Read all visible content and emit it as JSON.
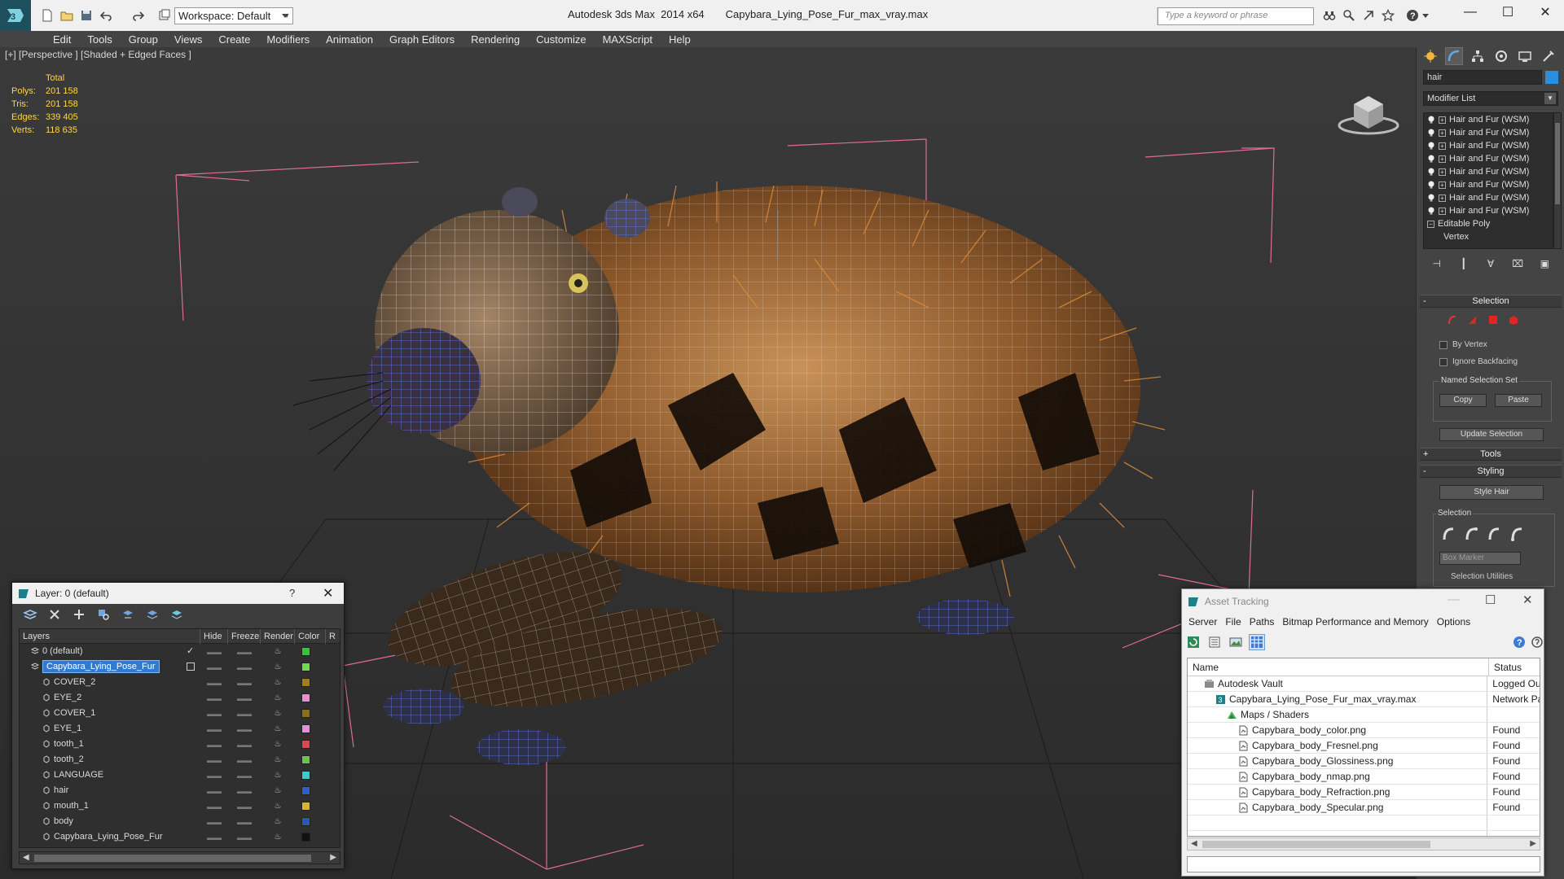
{
  "titlebar": {
    "workspace": "Workspace: Default",
    "app_name": "Autodesk 3ds Max  2014 x64",
    "file_name": "Capybara_Lying_Pose_Fur_max_vray.max",
    "search_placeholder": "Type a keyword or phrase"
  },
  "menu": [
    "Edit",
    "Tools",
    "Group",
    "Views",
    "Create",
    "Modifiers",
    "Animation",
    "Graph Editors",
    "Rendering",
    "Customize",
    "MAXScript",
    "Help"
  ],
  "viewport": {
    "label": "[+] [Perspective ] [Shaded + Edged Faces ]",
    "stats_header": "Total",
    "stats": [
      {
        "k": "Polys:",
        "v": "201 158"
      },
      {
        "k": "Tris:",
        "v": "201 158"
      },
      {
        "k": "Edges:",
        "v": "339 405"
      },
      {
        "k": "Verts:",
        "v": "118 635"
      }
    ]
  },
  "command_panel": {
    "search_value": "hair",
    "modifier_list": "Modifier List",
    "stack": [
      "Hair and Fur (WSM)",
      "Hair and Fur (WSM)",
      "Hair and Fur (WSM)",
      "Hair and Fur (WSM)",
      "Hair and Fur (WSM)",
      "Hair and Fur (WSM)",
      "Hair and Fur (WSM)",
      "Hair and Fur (WSM)"
    ],
    "base_object": "Editable Poly",
    "sub_object": "Vertex",
    "selection_rollout": "Selection",
    "by_vertex": "By Vertex",
    "ignore_backfacing": "Ignore Backfacing",
    "named_selection_set": "Named Selection Set",
    "copy": "Copy",
    "paste": "Paste",
    "update_selection": "Update Selection",
    "tools_rollout": "Tools",
    "styling_rollout": "Styling",
    "style_hair": "Style Hair",
    "selection_group": "Selection",
    "box_marker": "Box Marker",
    "selection_utilities": "Selection Utilities"
  },
  "layer_dialog": {
    "title": "Layer: 0 (default)",
    "help": "?",
    "columns": {
      "layers": "Layers",
      "hide": "Hide",
      "freeze": "Freeze",
      "render": "Render",
      "color": "Color",
      "extra": "R"
    },
    "rows": [
      {
        "name": "0 (default)",
        "color": "#3fbf3f",
        "level": 0,
        "selected": false
      },
      {
        "name": "Capybara_Lying_Pose_Fur",
        "color": "#6fd84f",
        "level": 0,
        "selected": true
      },
      {
        "name": "COVER_2",
        "color": "#a07d1e",
        "level": 1,
        "selected": false
      },
      {
        "name": "EYE_2",
        "color": "#e98fd0",
        "level": 1,
        "selected": false
      },
      {
        "name": "COVER_1",
        "color": "#8a6e1c",
        "level": 1,
        "selected": false
      },
      {
        "name": "EYE_1",
        "color": "#e48fd8",
        "level": 1,
        "selected": false
      },
      {
        "name": "tooth_1",
        "color": "#d94a4a",
        "level": 1,
        "selected": false
      },
      {
        "name": "tooth_2",
        "color": "#6cc24a",
        "level": 1,
        "selected": false
      },
      {
        "name": "LANGUAGE",
        "color": "#3fc9c9",
        "level": 1,
        "selected": false
      },
      {
        "name": "hair",
        "color": "#2a5fcf",
        "level": 1,
        "selected": false
      },
      {
        "name": "mouth_1",
        "color": "#d8b23c",
        "level": 1,
        "selected": false
      },
      {
        "name": "body",
        "color": "#2a57b8",
        "level": 1,
        "selected": false
      },
      {
        "name": "Capybara_Lying_Pose_Fur",
        "color": "#111111",
        "level": 1,
        "selected": false
      }
    ]
  },
  "asset_dialog": {
    "title": "Asset Tracking",
    "menu": [
      "Server",
      "File",
      "Paths",
      "Bitmap Performance and Memory",
      "Options"
    ],
    "col_name": "Name",
    "col_status": "Status",
    "rows": [
      {
        "name": "Autodesk Vault",
        "status": "Logged Out",
        "indent": 1,
        "icon": "vault"
      },
      {
        "name": "Capybara_Lying_Pose_Fur_max_vray.max",
        "status": "Network Pa",
        "indent": 2,
        "icon": "max"
      },
      {
        "name": "Maps / Shaders",
        "status": "",
        "indent": 3,
        "icon": "maps"
      },
      {
        "name": "Capybara_body_color.png",
        "status": "Found",
        "indent": 4,
        "icon": "file"
      },
      {
        "name": "Capybara_body_Fresnel.png",
        "status": "Found",
        "indent": 4,
        "icon": "file"
      },
      {
        "name": "Capybara_body_Glossiness.png",
        "status": "Found",
        "indent": 4,
        "icon": "file"
      },
      {
        "name": "Capybara_body_nmap.png",
        "status": "Found",
        "indent": 4,
        "icon": "file"
      },
      {
        "name": "Capybara_body_Refraction.png",
        "status": "Found",
        "indent": 4,
        "icon": "file"
      },
      {
        "name": "Capybara_body_Specular.png",
        "status": "Found",
        "indent": 4,
        "icon": "file"
      }
    ]
  }
}
